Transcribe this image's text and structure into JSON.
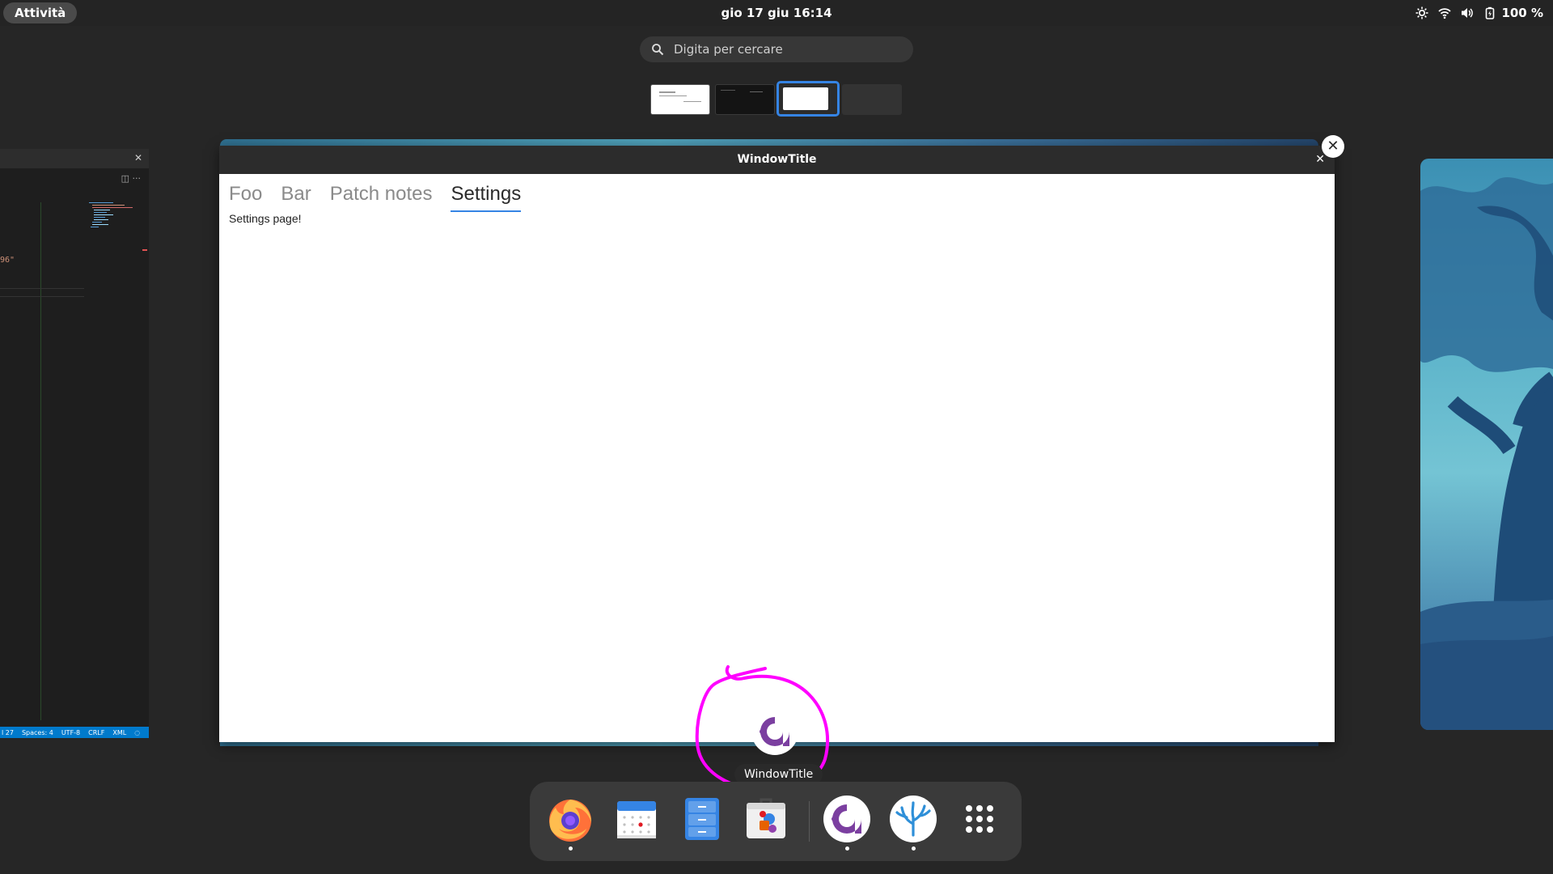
{
  "topbar": {
    "activities_label": "Attività",
    "clock": "gio 17 giu  16:14",
    "battery_label": "100 %",
    "tray_icons": [
      "brightness-icon",
      "wifi-icon",
      "volume-icon",
      "battery-icon"
    ]
  },
  "search": {
    "placeholder": "Digita per cercare"
  },
  "workspaces": {
    "count": 4,
    "active_index": 3
  },
  "editor": {
    "code_fragment": "96\"",
    "status_items": [
      "l 27",
      "Spaces: 4",
      "UTF-8",
      "CRLF",
      "XML"
    ]
  },
  "main_window": {
    "title": "WindowTitle",
    "tabs": [
      "Foo",
      "Bar",
      "Patch notes",
      "Settings"
    ],
    "active_tab": "Settings",
    "page_text": "Settings page!"
  },
  "hover": {
    "tooltip": "WindowTitle",
    "annotation_color": "#ff00ff"
  },
  "dock": {
    "items": [
      {
        "name": "firefox-icon",
        "running": true
      },
      {
        "name": "calendar-icon",
        "running": false
      },
      {
        "name": "files-icon",
        "running": false
      },
      {
        "name": "software-icon",
        "running": false
      },
      {
        "name": "app-a-icon",
        "running": true
      },
      {
        "name": "coral-app-icon",
        "running": true
      },
      {
        "name": "show-apps-icon",
        "running": false
      }
    ]
  },
  "colors": {
    "accent": "#3584e4",
    "app_purple": "#7b3fa0",
    "annotation": "#ff00ff"
  }
}
